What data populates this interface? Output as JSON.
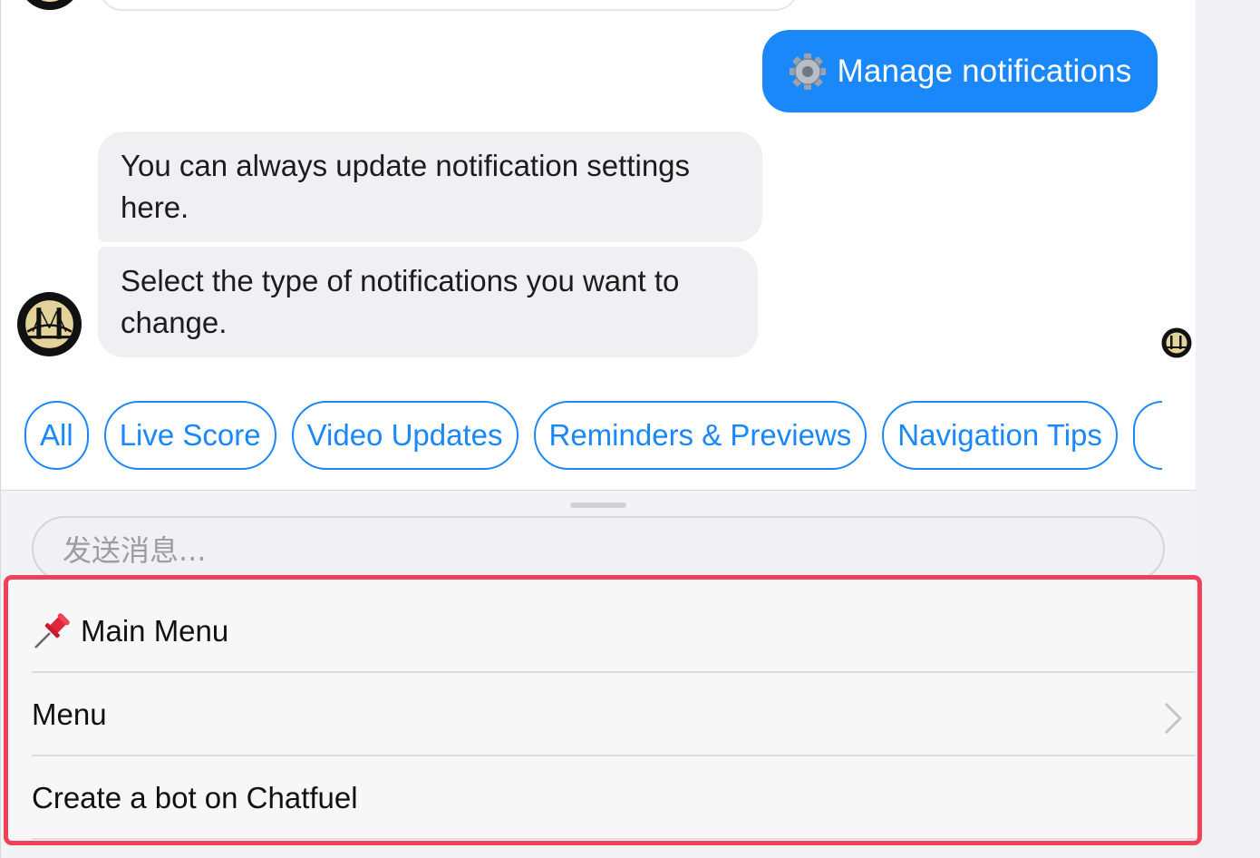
{
  "conversation": {
    "outgoing_message": "Manage notifications",
    "outgoing_icon": "gear-icon",
    "incoming_messages": [
      "You can always update notification settings here.",
      "Select the type of notifications you want to change."
    ],
    "avatar_icon": "team-logo-icon"
  },
  "quick_replies": [
    "All",
    "Live Score",
    "Video Updates",
    "Reminders & Previews",
    "Navigation Tips"
  ],
  "composer": {
    "placeholder": "发送消息..."
  },
  "persistent_menu": {
    "items": [
      {
        "label": "Main Menu",
        "icon": "pushpin-icon"
      },
      {
        "label": "Menu",
        "icon": "chevron-right-icon"
      },
      {
        "label": "Create a bot on Chatfuel"
      }
    ]
  },
  "colors": {
    "accent": "#1a88fb",
    "highlight": "#f0415a",
    "bubble_incoming": "#f0f0f2"
  }
}
